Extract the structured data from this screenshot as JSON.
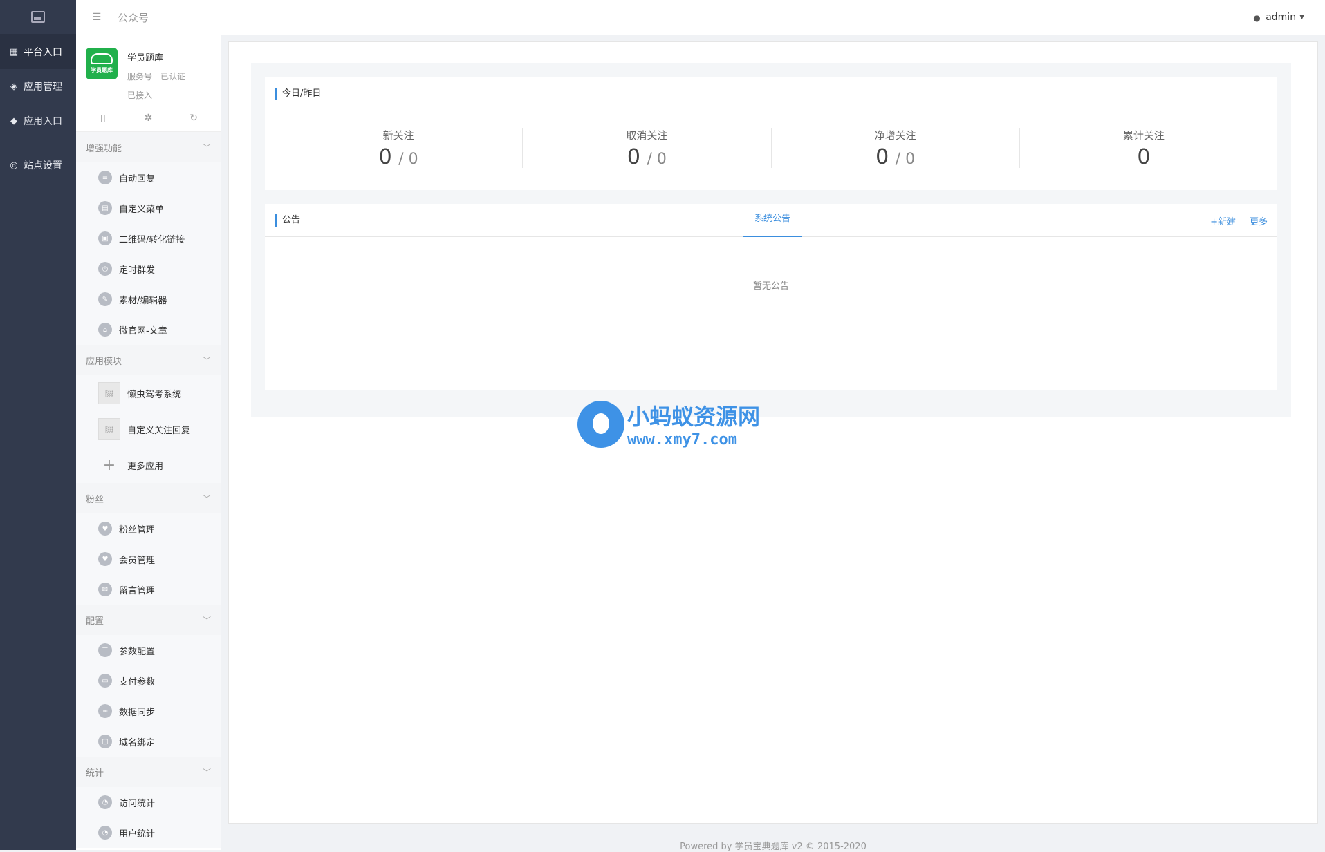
{
  "leftnav": {
    "items": [
      {
        "label": "平台入口",
        "icon": "grid-icon",
        "active": true
      },
      {
        "label": "应用管理",
        "icon": "cubes-icon",
        "active": false
      },
      {
        "label": "应用入口",
        "icon": "cube-icon",
        "active": false
      },
      {
        "label": "站点设置",
        "icon": "globe-icon",
        "active": false
      }
    ]
  },
  "subnav": {
    "title": "公众号",
    "account": {
      "name": "学员题库",
      "logo_text": "学员题库",
      "type": "服务号",
      "verified": "已认证",
      "status": "已接入"
    },
    "groups": [
      {
        "title": "增强功能",
        "items": [
          "自动回复",
          "自定义菜单",
          "二维码/转化链接",
          "定时群发",
          "素材/编辑器",
          "微官网-文章"
        ]
      },
      {
        "title": "应用模块",
        "items": [
          "懒虫驾考系统",
          "自定义关注回复",
          "更多应用"
        ]
      },
      {
        "title": "粉丝",
        "items": [
          "粉丝管理",
          "会员管理",
          "留言管理"
        ]
      },
      {
        "title": "配置",
        "items": [
          "参数配置",
          "支付参数",
          "数据同步",
          "域名绑定"
        ]
      },
      {
        "title": "统计",
        "items": [
          "访问统计",
          "用户统计"
        ]
      }
    ]
  },
  "topbar": {
    "user": "admin"
  },
  "stats": {
    "title": "今日/昨日",
    "items": [
      {
        "label": "新关注",
        "today": "0",
        "yesterday": "/ 0"
      },
      {
        "label": "取消关注",
        "today": "0",
        "yesterday": "/ 0"
      },
      {
        "label": "净增关注",
        "today": "0",
        "yesterday": "/ 0"
      },
      {
        "label": "累计关注",
        "today": "0"
      }
    ]
  },
  "notice": {
    "title": "公告",
    "tab": "系统公告",
    "new": "+新建",
    "more": "更多",
    "empty": "暂无公告"
  },
  "watermark": {
    "cn": "小蚂蚁资源网",
    "url": "www.xmy7.com"
  },
  "footer": "Powered by 学员宝典题库 v2 © 2015-2020",
  "colors": {
    "sidebar_dark": "#323a4d",
    "accent": "#3b8ede",
    "logo_green": "#21b04b"
  }
}
